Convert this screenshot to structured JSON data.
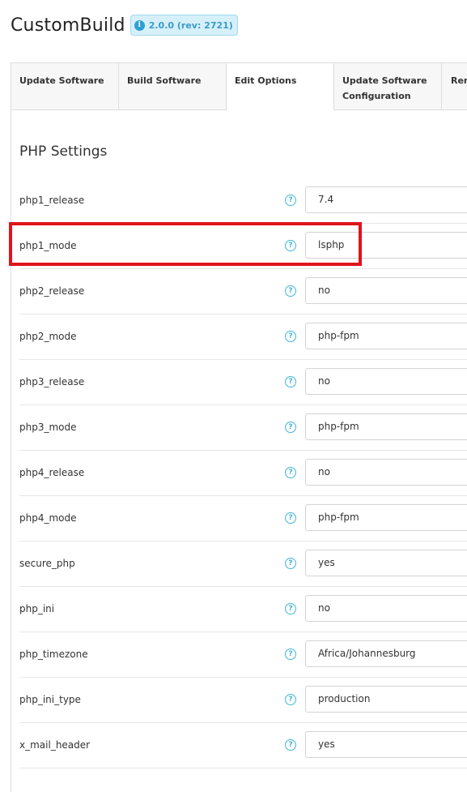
{
  "header": {
    "title": "CustomBuild",
    "version_text": "2.0.0 (rev: 2721)",
    "version_icon": "info-icon"
  },
  "tabs": [
    {
      "label": "Update Software",
      "active": false
    },
    {
      "label": "Build Software",
      "active": false
    },
    {
      "label": "Edit Options",
      "active": true
    },
    {
      "label": "Update Software Configuration",
      "active": false
    },
    {
      "label": "Rem",
      "active": false
    }
  ],
  "section": {
    "title": "PHP Settings"
  },
  "settings": [
    {
      "name": "php1_release",
      "value": "7.4"
    },
    {
      "name": "php1_mode",
      "value": "lsphp"
    },
    {
      "name": "php2_release",
      "value": "no"
    },
    {
      "name": "php2_mode",
      "value": "php-fpm"
    },
    {
      "name": "php3_release",
      "value": "no"
    },
    {
      "name": "php3_mode",
      "value": "php-fpm"
    },
    {
      "name": "php4_release",
      "value": "no"
    },
    {
      "name": "php4_mode",
      "value": "php-fpm"
    },
    {
      "name": "secure_php",
      "value": "yes"
    },
    {
      "name": "php_ini",
      "value": "no"
    },
    {
      "name": "php_timezone",
      "value": "Africa/Johannesburg"
    },
    {
      "name": "php_ini_type",
      "value": "production"
    },
    {
      "name": "x_mail_header",
      "value": "yes"
    }
  ],
  "help_glyph": "?",
  "highlighted_setting": "php1_mode",
  "colors": {
    "accent": "#3fb6d8",
    "highlight": "#e0141a",
    "badge_bg": "#d6f0fa"
  }
}
